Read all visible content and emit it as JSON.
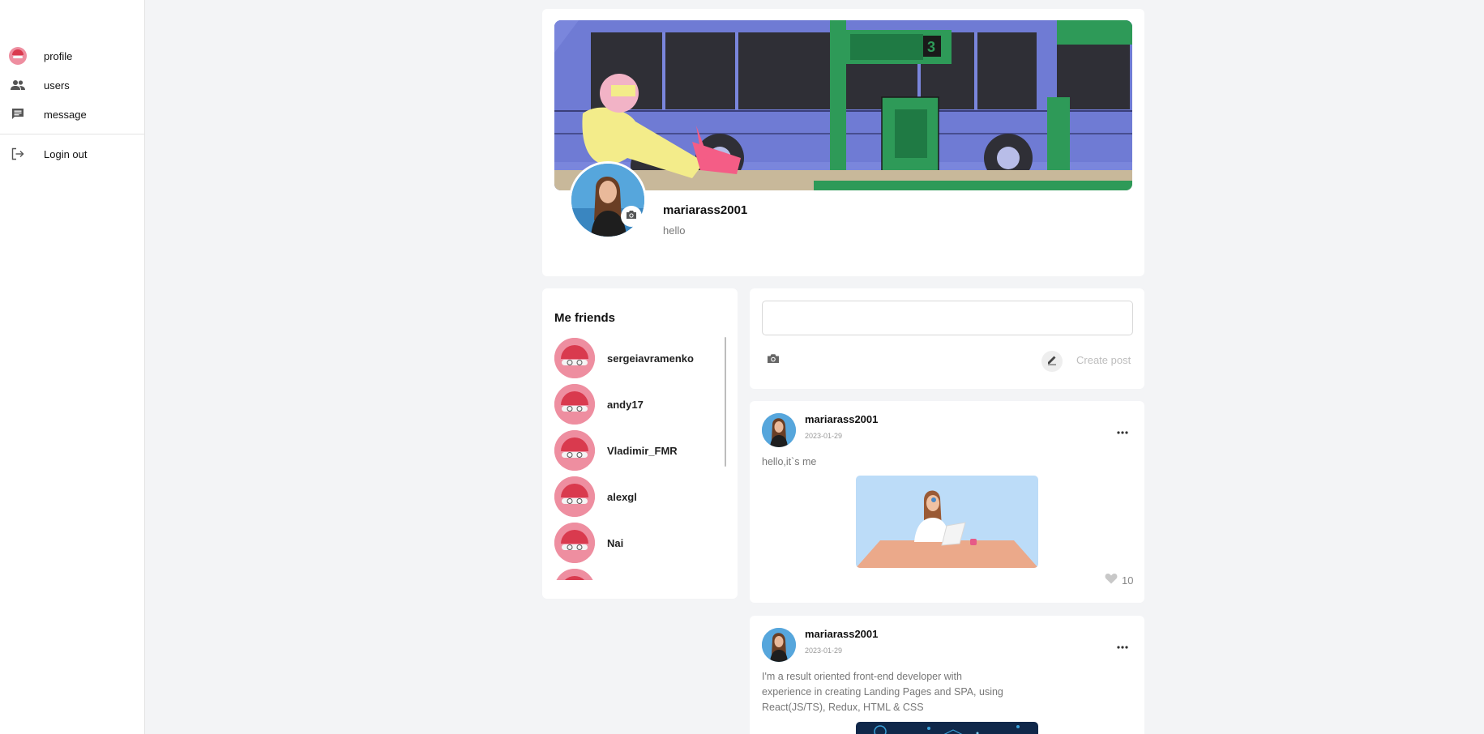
{
  "sidebar": {
    "items": [
      {
        "label": "profile",
        "icon": "profile-avatar-icon"
      },
      {
        "label": "users",
        "icon": "users-icon"
      },
      {
        "label": "message",
        "icon": "message-icon"
      }
    ],
    "logout": {
      "label": "Login out",
      "icon": "logout-icon"
    }
  },
  "profile": {
    "name": "mariarass2001",
    "status": "hello"
  },
  "friends": {
    "title": "Me friends",
    "items": [
      {
        "name": "sergeiavramenko"
      },
      {
        "name": "andy17"
      },
      {
        "name": "Vladimir_FMR"
      },
      {
        "name": "alexgl"
      },
      {
        "name": "Nai"
      },
      {
        "name": ""
      }
    ]
  },
  "create_post": {
    "placeholder": "",
    "button_label": "Create post"
  },
  "posts": [
    {
      "author": "mariarass2001",
      "date": "2023-01-29",
      "text": "hello,it`s me",
      "likes": "10"
    },
    {
      "author": "mariarass2001",
      "date": "2023-01-29",
      "text_lines": [
        "I'm a result oriented front-end developer with",
        "experience in creating Landing Pages and SPA, using",
        "React(JS/TS), Redux, HTML & CSS"
      ]
    }
  ],
  "colors": {
    "accent_pink": "#ee8ea0",
    "cover_blue": "#7480d8",
    "cover_green": "#2e9a58",
    "like_heart": "#c8c8c8"
  }
}
